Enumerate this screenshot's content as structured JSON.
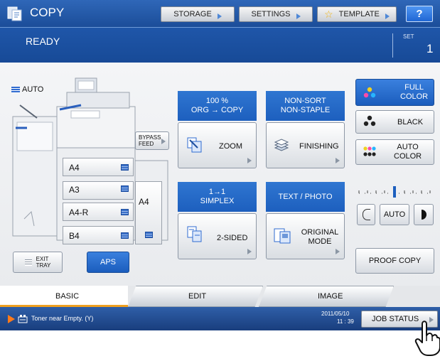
{
  "header": {
    "app_title": "COPY",
    "storage_label": "STORAGE",
    "settings_label": "SETTINGS",
    "template_label": "TEMPLATE",
    "help_label": "?"
  },
  "status": {
    "state_text": "READY",
    "set_label": "SET",
    "set_value": "1"
  },
  "paper": {
    "auto_label": "AUTO",
    "bypass_label_line1": "BYPASS",
    "bypass_label_line2": "FEED",
    "trays": [
      "A4",
      "A3",
      "A4-R",
      "B4"
    ],
    "lcf_label": "A4",
    "exit_tray_line1": "EXIT",
    "exit_tray_line2": "TRAY",
    "aps_label": "APS"
  },
  "zoom": {
    "header_line1": "100 %",
    "header_line2": "ORG → COPY",
    "button_label": "ZOOM"
  },
  "finishing": {
    "header_line1": "NON-SORT",
    "header_line2": "NON-STAPLE",
    "button_label": "FINISHING"
  },
  "sided": {
    "header_line1": "1→1",
    "header_line2": "SIMPLEX",
    "button_label": "2-SIDED"
  },
  "original": {
    "header_line1": "TEXT / PHOTO",
    "button_line1": "ORIGINAL",
    "button_line2": "MODE"
  },
  "color": {
    "full_line1": "FULL",
    "full_line2": "COLOR",
    "black_label": "BLACK",
    "auto_line1": "AUTO",
    "auto_line2": "COLOR"
  },
  "density": {
    "auto_label": "AUTO",
    "level_fraction": 0.5
  },
  "proof_copy_label": "PROOF COPY",
  "tabs": [
    "BASIC",
    "EDIT",
    "IMAGE"
  ],
  "footer": {
    "message": "Toner near Empty. (Y)",
    "date": "2011/05/10",
    "time": "11 : 39",
    "job_status_label": "JOB STATUS"
  },
  "colors": {
    "header_blue": "#1d5fbe",
    "active_tab_accent": "#f0a020",
    "help_button": "#2a78e6"
  }
}
